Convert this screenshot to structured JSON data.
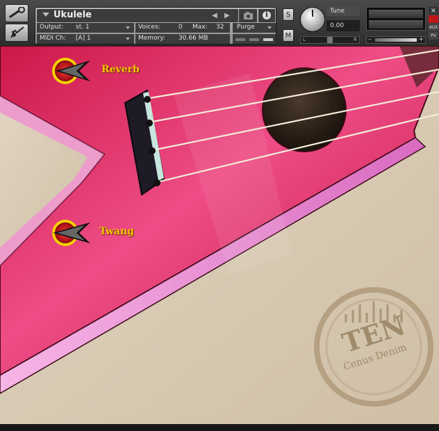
{
  "instrument": {
    "name": "Ukulele",
    "output_label": "Output:",
    "output_value": "st. 1",
    "midi_label": "MIDI Ch:",
    "midi_value": "[A]  1",
    "voices_label": "Voices:",
    "voices_value": "0",
    "max_label": "Max:",
    "max_value": "32",
    "memory_label": "Memory:",
    "memory_value": "30.66 MB",
    "purge_label": "Purge"
  },
  "controls": {
    "solo_label": "S",
    "mute_label": "M",
    "tune_label": "Tune",
    "tune_value": "0.00",
    "pan_left": "L",
    "pan_right": "R",
    "volume_minus": "–",
    "volume_plus": "+",
    "aux_label": "AUX",
    "pv_label": "PV",
    "close_label": "×"
  },
  "gui": {
    "reverb_label": "Reverb",
    "twang_label": "Twang",
    "logo_text_main": "TEN",
    "logo_text_sub": "Cenus Denim"
  },
  "colors": {
    "guitar_body": "#e0306a",
    "guitar_edge": "#f49ad6",
    "sand": "#d9cbb4",
    "label_gold": "#f5c400"
  },
  "icons": {
    "wrench": "wrench-icon",
    "guitar": "guitar-icon",
    "camera": "camera-icon",
    "info": "info-icon"
  }
}
